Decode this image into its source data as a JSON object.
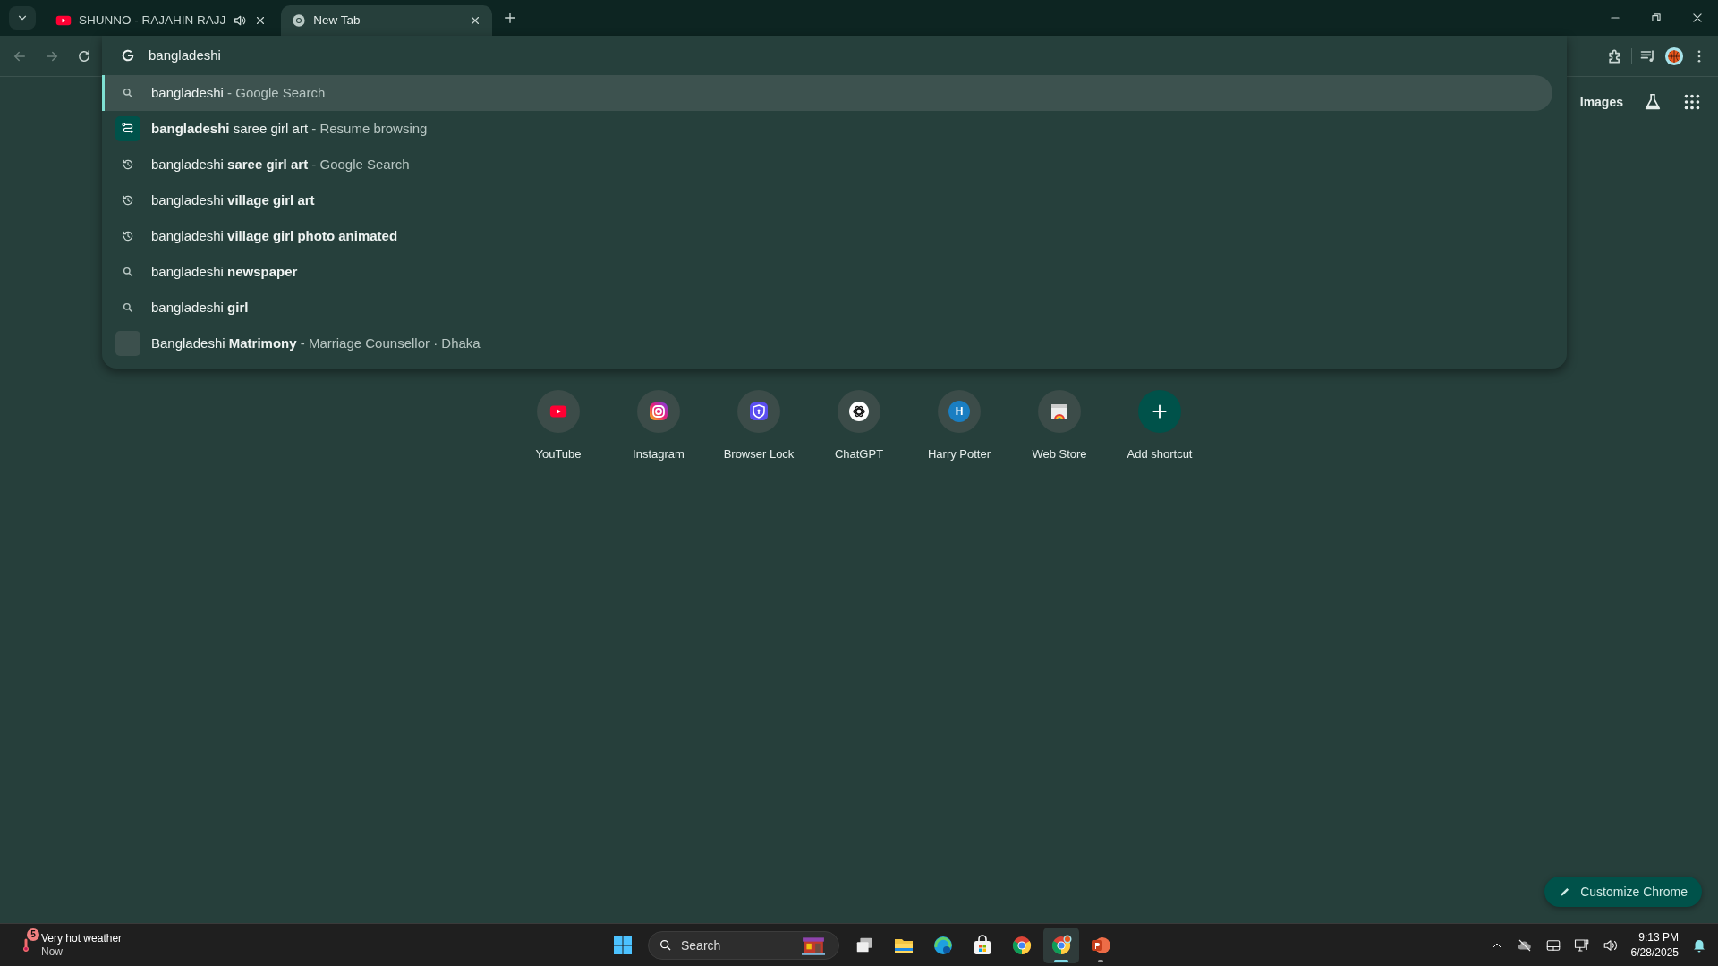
{
  "tabs": [
    {
      "title": "SHUNNO - RAJAHIN RAJJ",
      "kind": "youtube",
      "audio_playing": true,
      "selected": false
    },
    {
      "title": "New Tab",
      "kind": "chrome",
      "audio_playing": false,
      "selected": true
    }
  ],
  "omnibox": {
    "value": "bangladeshi",
    "suggestions": [
      {
        "kind": "search",
        "text": "bangladeshi",
        "detail": "- Google Search",
        "selected": true
      },
      {
        "kind": "journey",
        "text": "**bangladeshi** saree girl art",
        "detail": "- Resume browsing",
        "selected": false
      },
      {
        "kind": "history",
        "text": "bangladeshi **saree girl art**",
        "detail": "- Google Search",
        "selected": false
      },
      {
        "kind": "history",
        "text": "bangladeshi **village girl art**",
        "selected": false
      },
      {
        "kind": "history",
        "text": "bangladeshi **village girl photo animated**",
        "selected": false
      },
      {
        "kind": "search",
        "text": "bangladeshi **newspaper**",
        "selected": false
      },
      {
        "kind": "search",
        "text": "bangladeshi **girl**",
        "selected": false
      },
      {
        "kind": "entity",
        "text": "Bangladeshi **Matrimony**",
        "detail": "- Marriage Counsellor · Dhaka",
        "selected": false
      }
    ]
  },
  "header_links": [
    "Images"
  ],
  "shortcuts": [
    {
      "label": "YouTube",
      "kind": "youtube"
    },
    {
      "label": "Instagram",
      "kind": "instagram"
    },
    {
      "label": "Browser Lock",
      "kind": "shield"
    },
    {
      "label": "ChatGPT",
      "kind": "chatgpt"
    },
    {
      "label": "Harry Potter",
      "kind": "letter",
      "letter": "H"
    },
    {
      "label": "Web Store",
      "kind": "webstore"
    },
    {
      "label": "Add shortcut",
      "kind": "add"
    }
  ],
  "customize_button": "Customize Chrome",
  "taskbar": {
    "weather": {
      "title": "Very hot weather",
      "subtitle": "Now",
      "badge": "5"
    },
    "search_placeholder": "Search",
    "apps": [
      {
        "kind": "taskview",
        "running": false,
        "selected": false
      },
      {
        "kind": "explorer",
        "running": false,
        "selected": false
      },
      {
        "kind": "edge",
        "running": false,
        "selected": false
      },
      {
        "kind": "store",
        "running": false,
        "selected": false
      },
      {
        "kind": "chrome",
        "running": false,
        "selected": false
      },
      {
        "kind": "chrome-profile",
        "running": true,
        "selected": true
      },
      {
        "kind": "powerpoint",
        "running": true,
        "selected": false
      }
    ],
    "time": "9:13 PM",
    "date": "6/28/2025"
  }
}
